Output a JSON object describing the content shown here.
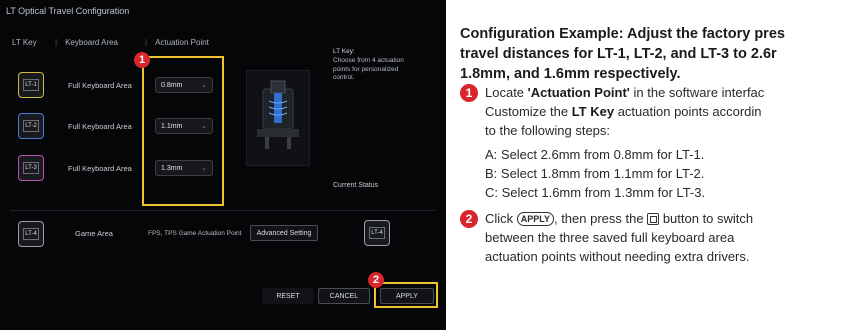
{
  "screenshot": {
    "window_title": "LT Optical Travel Configuration",
    "headers": {
      "lt_key": "LT Key",
      "keyboard_area": "Keyboard Area",
      "actuation_point": "Actuation Point"
    },
    "rows": [
      {
        "key": "LT-1",
        "area": "Full Keyboard Area",
        "value": "0.8mm",
        "accent": "#d2b93a"
      },
      {
        "key": "LT-2",
        "area": "Full Keyboard Area",
        "value": "1.1mm",
        "accent": "#4a7fd8"
      },
      {
        "key": "LT-3",
        "area": "Full Keyboard Area",
        "value": "1.3mm",
        "accent": "#c14fb5"
      }
    ],
    "game_row": {
      "key": "LT-4",
      "area": "Game Area",
      "text": "FPS, TPS Game Actuation Point",
      "button": "Advanced Setting"
    },
    "side_note": {
      "title": "LT Key:",
      "text": "Choose from 4 actuation points for personalized control."
    },
    "current_status": "Current Status",
    "buttons": {
      "reset": "RESET",
      "cancel": "CANCEL",
      "apply": "APPLY"
    },
    "badges": {
      "one": "1",
      "two": "2"
    },
    "highlight_color": "#f3c232"
  },
  "instructions": {
    "title_lines": [
      "Configuration Example: Adjust the factory pres",
      "travel distances for LT-1, LT-2, and LT-3 to 2.6r",
      "1.8mm, and 1.6mm respectively."
    ],
    "step1": {
      "badge": "1",
      "pre": "Locate ",
      "bold1": "'Actuation Point'",
      "post": " in the software interfac",
      "line2_pre": "Customize the ",
      "line2_bold": "LT Key",
      "line2_post": " actuation points accordin",
      "line3": "to the following steps:",
      "a": "A: Select 2.6mm from 0.8mm for LT-1.",
      "b": "B: Select 1.8mm from 1.1mm for LT-2.",
      "c": "C: Select 1.6mm from 1.3mm for LT-3."
    },
    "step2": {
      "badge": "2",
      "pre": "Click ",
      "pill": "APPLY",
      "mid": ", then press the ",
      "post": " button to switch",
      "line2": "between the three saved full keyboard area",
      "line3": "actuation points without needing extra drivers."
    }
  }
}
